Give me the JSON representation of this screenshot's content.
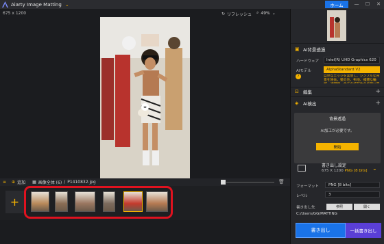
{
  "titlebar": {
    "app_title": "Aiarty Image Matting",
    "home_label": "ホーム",
    "minimize": "—",
    "maximize": "☐",
    "close": "✕"
  },
  "canvas": {
    "dimensions": "675 x 1200",
    "refresh_label": "リフレッシュ",
    "zoom_value": "49%"
  },
  "bottom_bar": {
    "add_label": "追加",
    "all_images_label": "画像全体 (6)",
    "separator": "/",
    "filename": "P1410832.jpg"
  },
  "thumbnails": {
    "count": 6,
    "selected_index": 4,
    "colors": [
      "#b98a5a",
      "#8a6d55",
      "#9a7660",
      "#7c6a5c",
      "#c43a2d",
      "#b57a52"
    ]
  },
  "panel": {
    "ai_bg_title": "AI背景透過",
    "hardware_label": "ハードウェア",
    "hardware_value": "Intel(R) UHD Graphics 620",
    "ai_model_label": "AIモデル",
    "ai_model_value": "AlphaStandard  V2",
    "model_desc": "自然なエッジを実現し、シンプルな背景を除去。髪の毛、布地、複雑な輪郭、透明物、全ての被写体の処理に最適。",
    "edit_title": "編集",
    "ai_detect_title": "AI検出",
    "popup_title": "背景透過",
    "popup_msg": "AI加工が必要です。",
    "start_label": "開始",
    "export_title": "書き出し設定",
    "export_size": "675 X 1200",
    "export_format": "PNG",
    "export_bits": "[8 bits]",
    "format_label": "フォーマット",
    "format_value": "PNG  [8 bits]",
    "level_label": "レベル",
    "level_value": "3",
    "dest_label": "書き出し先",
    "browse_label": "参照",
    "open_label": "開く",
    "path": "C:/Users/GG/MATTING",
    "export_button": "書き出し",
    "batch_export_button": "一括書き出し"
  }
}
